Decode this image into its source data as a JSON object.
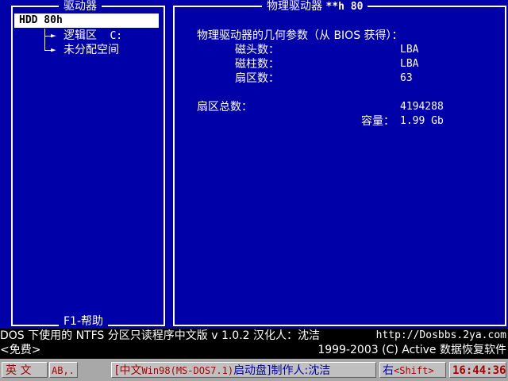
{
  "left_panel": {
    "title": "驱动器",
    "selected": "HDD 80h",
    "items": [
      {
        "label": "逻辑区",
        "drive": "C:"
      },
      {
        "label": "未分配空间"
      }
    ],
    "footer": "F1-帮助"
  },
  "right_panel": {
    "title_cn": "物理驱动器",
    "title_code": "**h 80",
    "geometry_heading": "物理驱动器的几何参数（从 BIOS 获得）：",
    "rows": [
      {
        "label": "磁头数：",
        "value": "LBA"
      },
      {
        "label": "磁柱数：",
        "value": "LBA"
      },
      {
        "label": "扇区数：",
        "value": "63"
      }
    ],
    "total_sectors_label": "扇区总数：",
    "total_sectors_value": "4194288",
    "capacity_label": "容量：",
    "capacity_value": "1.99 Gb"
  },
  "info_bar": {
    "line1_left": "DOS 下使用的 NTFS 分区只读程序中文版 v 1.0.2 汉化人：沈洁",
    "line1_right": "http://Dosbbs.2ya.com",
    "line2_left": "<免费>",
    "line2_right": "1999-2003 (C) Active 数据恢复软件"
  },
  "status_bar": {
    "ime": "英 文",
    "mode": "AB,.",
    "boot_prefix": "[中文",
    "boot_name": "Win98(MS-DOS7.1)",
    "boot_suffix": "启动盘]制作人:沈洁",
    "key_hint_prefix": "右",
    "key_hint_key": "<Shift>",
    "clock": "16:44:36"
  }
}
